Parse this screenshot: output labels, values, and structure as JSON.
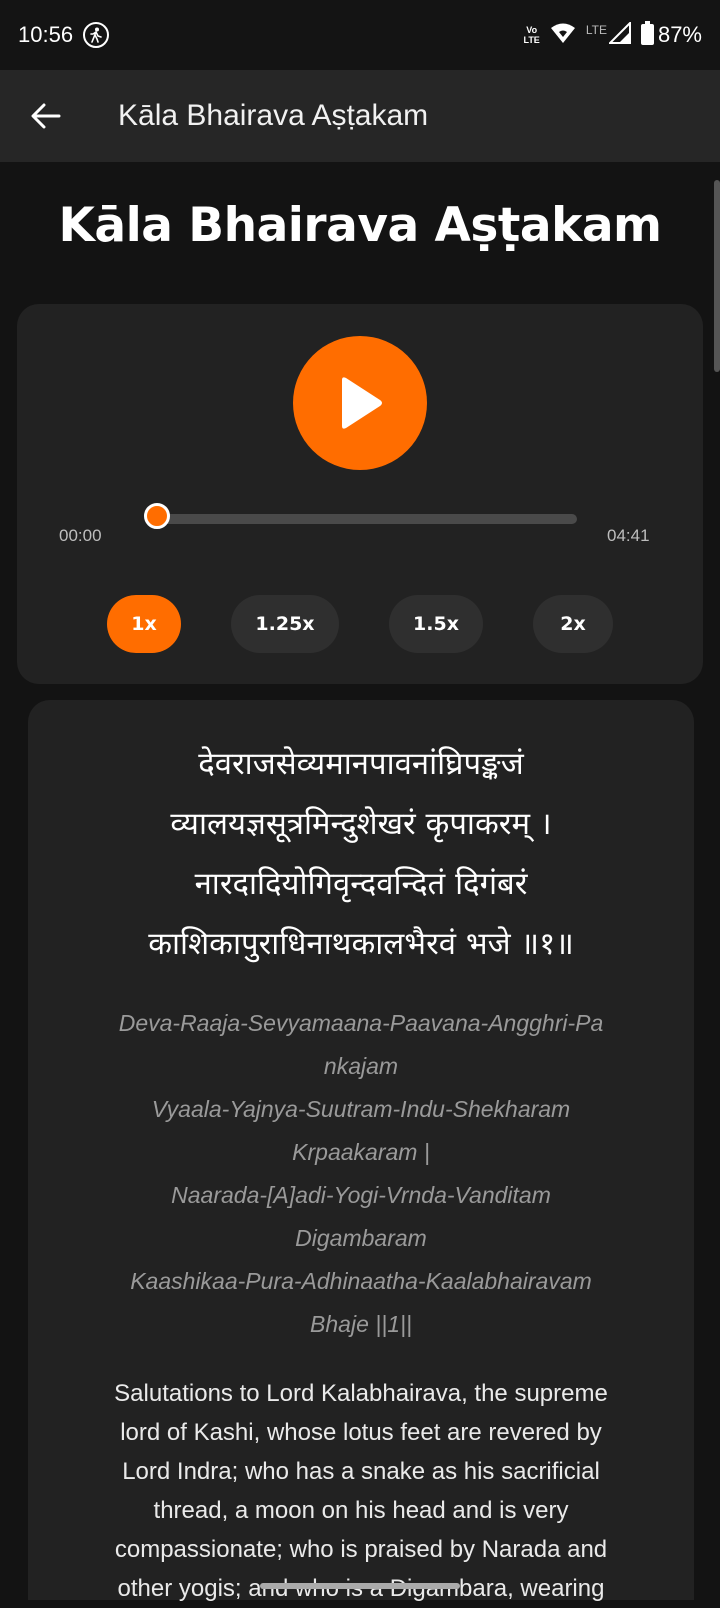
{
  "status_bar": {
    "time": "10:56",
    "volte_top": "Vo",
    "volte_bottom": "LTE",
    "network": "LTE",
    "battery": "87%",
    "icons": [
      "walk-icon",
      "wifi-icon",
      "signal-icon",
      "battery-icon"
    ]
  },
  "app_bar": {
    "title": "Kāla Bhairava Aṣṭakam",
    "back_icon": "arrow-left-icon"
  },
  "page_title": "Kāla Bhairava Aṣṭakam",
  "player": {
    "play_icon": "play-icon",
    "current_time": "00:00",
    "total_time": "04:41",
    "progress": 0.0,
    "accent_color": "#ff6d00",
    "speeds": [
      {
        "label": "1x",
        "active": true
      },
      {
        "label": "1.25x",
        "active": false
      },
      {
        "label": "1.5x",
        "active": false
      },
      {
        "label": "2x",
        "active": false
      }
    ]
  },
  "verse": {
    "sanskrit": [
      "देवराजसेव्यमानपावनांघ्रिपङ्कजं",
      "व्यालयज्ञसूत्रमिन्दुशेखरं कृपाकरम् ।",
      "नारदादियोगिवृन्दवन्दितं दिगंबरं",
      "काशिकापुराधिनाथकालभैरवं भजे ॥१॥"
    ],
    "transliteration": [
      "Deva-Raaja-Sevyamaana-Paavana-Angghri-Pa",
      "nkajam",
      "Vyaala-Yajnya-Suutram-Indu-Shekharam",
      "Krpaakaram |",
      "Naarada-[A]adi-Yogi-Vrnda-Vanditam",
      "Digambaram",
      "Kaashikaa-Pura-Adhinaatha-Kaalabhairavam",
      "Bhaje ||1||"
    ],
    "translation": [
      "Salutations to Lord Kalabhairava, the supreme",
      "lord of Kashi, whose lotus feet are revered by",
      "Lord Indra; who has a snake as his sacrificial",
      "thread, a moon on his head and is very",
      "compassionate; who is praised by Narada and",
      "other yogis; and who is a Digambara, wearing"
    ]
  }
}
